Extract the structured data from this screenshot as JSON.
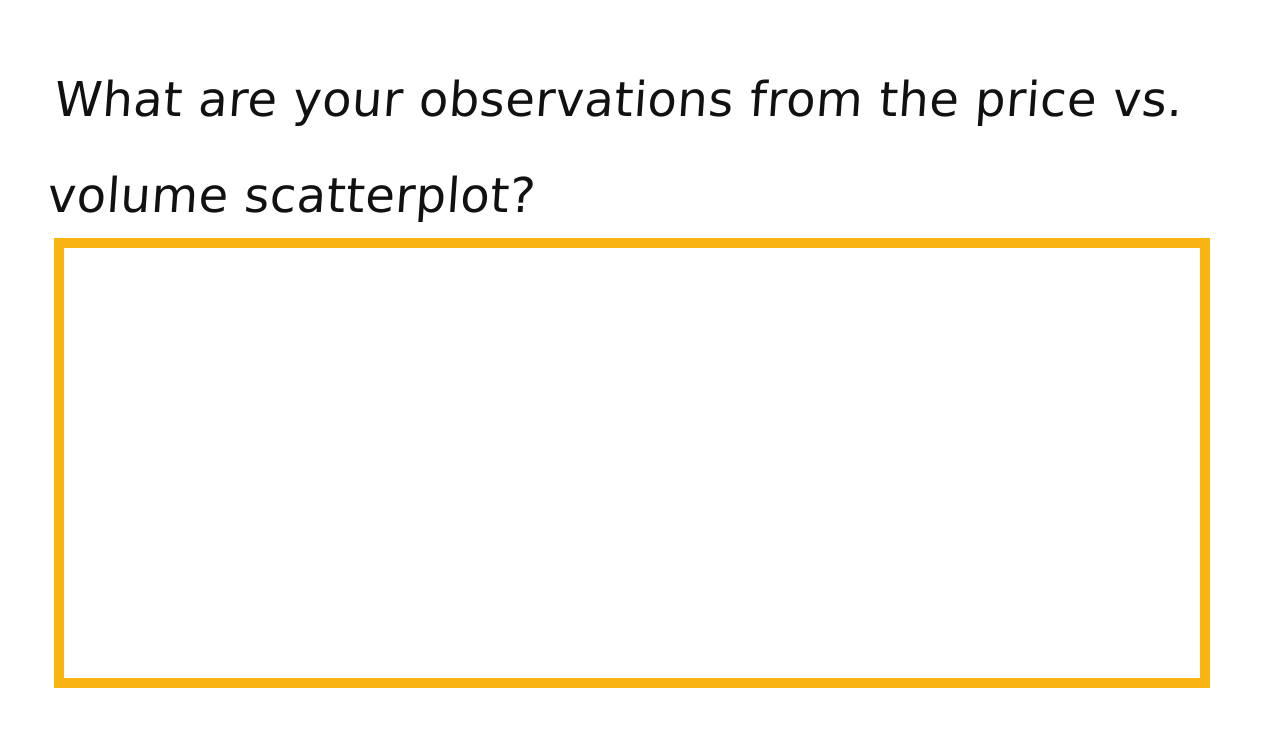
{
  "question": {
    "line1": "What are your observations from the price vs.",
    "line2": "volume scatterplot?"
  },
  "answer_box": {
    "value": "",
    "border_color": "#F9B412"
  }
}
